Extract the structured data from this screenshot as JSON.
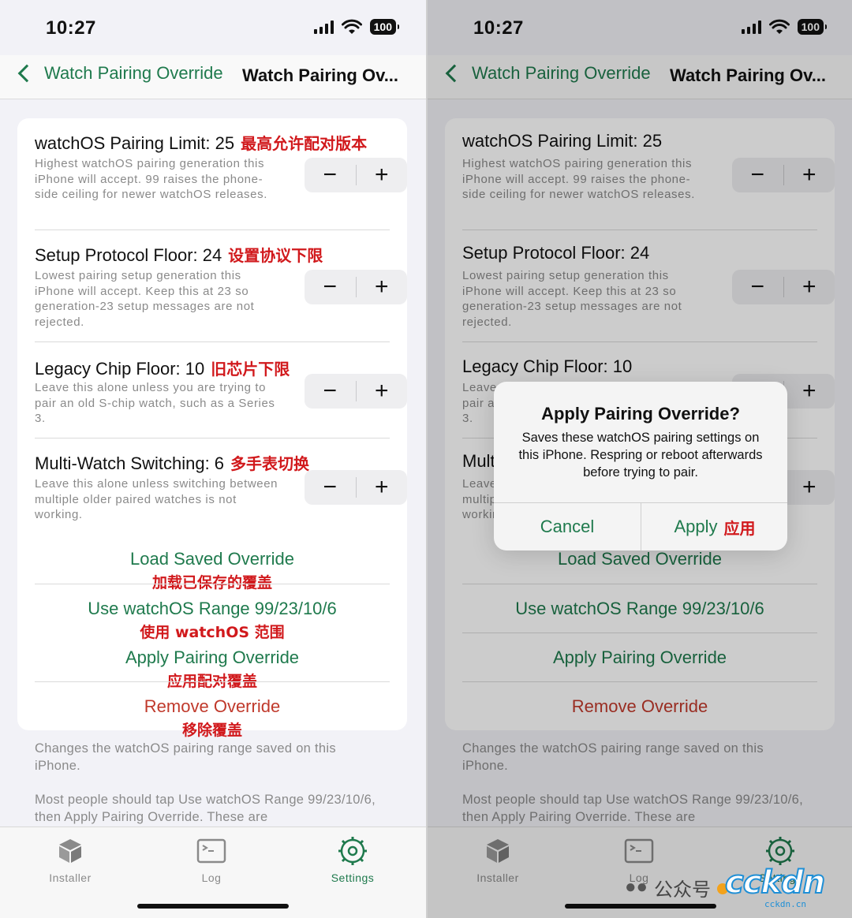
{
  "status": {
    "time": "10:27",
    "battery": "100"
  },
  "nav": {
    "back_label": "Watch Pairing Override",
    "title": "Watch Pairing Ov..."
  },
  "settings": [
    {
      "title": "watchOS Pairing Limit: 25",
      "title_cn": "最高允许配对版本",
      "desc": "Highest watchOS pairing generation this iPhone will accept. 99 raises the phone-side ceiling for newer watchOS releases.",
      "minus": "−",
      "plus": "+"
    },
    {
      "title": "Setup Protocol Floor: 24",
      "title_cn": "设置协议下限",
      "desc": "Lowest pairing setup generation this iPhone will accept. Keep this at 23 so generation-23 setup messages are not rejected.",
      "minus": "−",
      "plus": "+"
    },
    {
      "title": "Legacy Chip Floor: 10",
      "title_cn": "旧芯片下限",
      "desc": "Leave this alone unless you are trying to pair an old S-chip watch, such as a Series 3.",
      "minus": "−",
      "plus": "+"
    },
    {
      "title": "Multi-Watch Switching: 6",
      "title_cn": "多手表切换",
      "desc": "Leave this alone unless switching between multiple older paired watches is not working.",
      "minus": "−",
      "plus": "+"
    }
  ],
  "actions": [
    {
      "label": "Load Saved Override",
      "label_cn": "加载已保存的覆盖",
      "color": "#1f7a4d"
    },
    {
      "label": "Use watchOS Range 99/23/10/6",
      "label_cn": "使用 watchOS 范围",
      "color": "#1f7a4d"
    },
    {
      "label": "Apply Pairing Override",
      "label_cn": "应用配对覆盖",
      "color": "#1f7a4d"
    },
    {
      "label": "Remove Override",
      "label_cn": "移除覆盖",
      "color": "#c0392b"
    }
  ],
  "footer": {
    "p1": "Changes the watchOS pairing range saved on this iPhone.",
    "p2": "Most people should tap Use watchOS Range 99/23/10/6, then Apply Pairing Override. These are"
  },
  "tabs": [
    {
      "label": "Installer",
      "icon": "box-icon"
    },
    {
      "label": "Log",
      "icon": "terminal-icon"
    },
    {
      "label": "Settings",
      "icon": "gear-icon",
      "active": true
    }
  ],
  "alert": {
    "title": "Apply Pairing Override?",
    "message": "Saves these watchOS pairing settings on this iPhone. Respring or reboot afterwards before trying to pair.",
    "cancel": "Cancel",
    "apply": "Apply",
    "apply_cn": "应用"
  },
  "watermark": {
    "text": "公众号",
    "logo": "cckdn",
    "domain": "cckdn.cn"
  },
  "colors": {
    "accent": "#1f7a4d",
    "destructive": "#c0392b",
    "annotation": "#d1191c"
  }
}
